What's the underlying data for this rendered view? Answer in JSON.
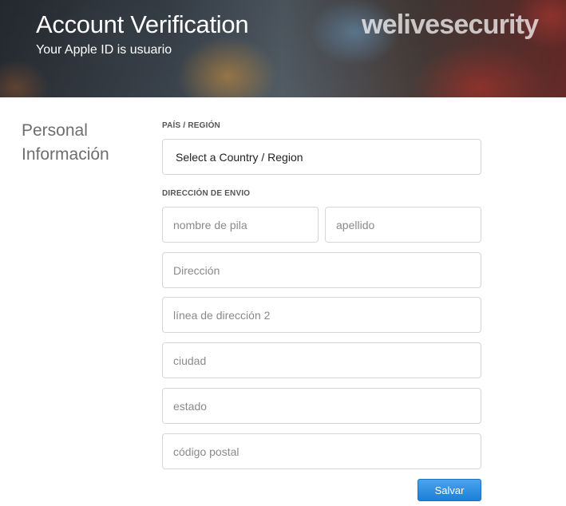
{
  "header": {
    "title": "Account Verification",
    "subtitle": "Your Apple ID is usuario",
    "brand": "welivesecurity"
  },
  "section": {
    "title_line1": "Personal",
    "title_line2": "Información"
  },
  "country": {
    "label": "PAÍS / REGIÓN",
    "selected": "Select a Country / Region"
  },
  "shipping": {
    "label": "DIRECCIÓN DE ENVIO",
    "first_name_placeholder": "nombre de pila",
    "last_name_placeholder": "apellido",
    "address_placeholder": "Dirección",
    "address2_placeholder": "línea de dirección 2",
    "city_placeholder": "ciudad",
    "state_placeholder": "estado",
    "zip_placeholder": "código postal"
  },
  "actions": {
    "save_label": "Salvar"
  },
  "colors": {
    "accent": "#1c7fd8",
    "border": "#d6d6d6"
  }
}
